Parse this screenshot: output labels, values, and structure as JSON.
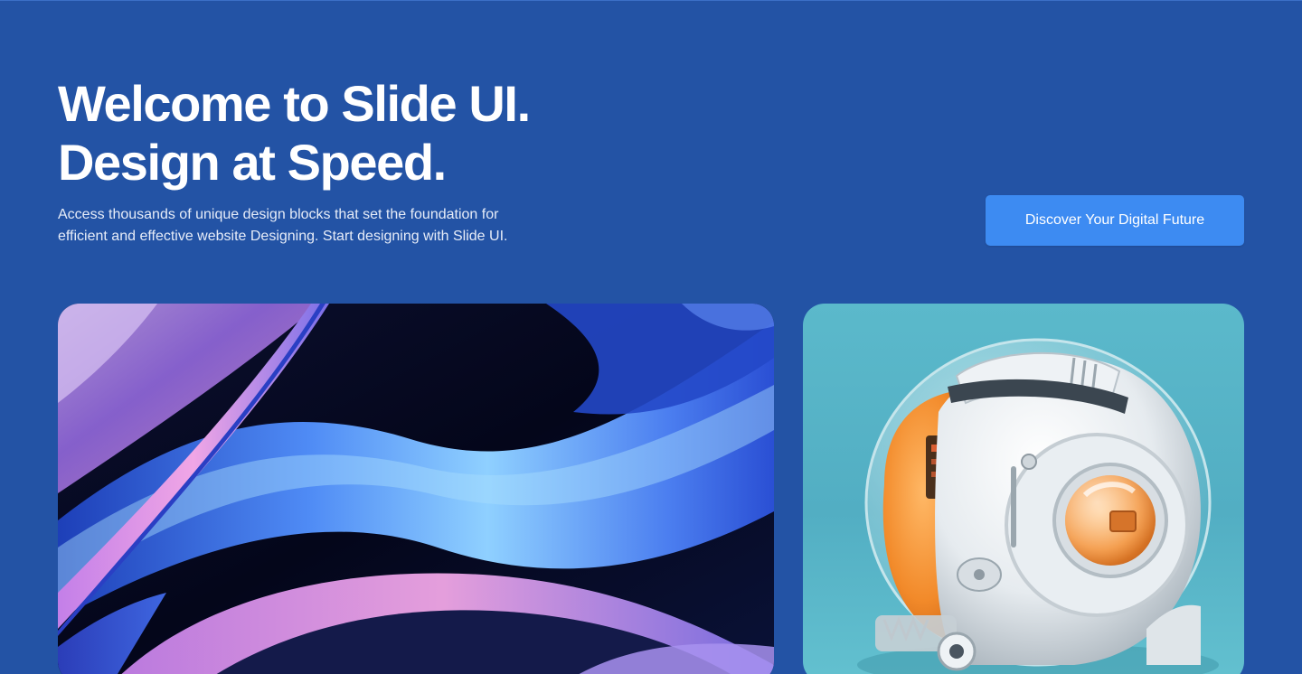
{
  "hero": {
    "headline_line1": "Welcome to Slide UI.",
    "headline_line2": "Design at Speed.",
    "subtext_line1": "Access thousands of unique design blocks that set the foundation for",
    "subtext_line2": "efficient and effective website Designing. Start designing with Slide UI.",
    "cta_label": "Discover Your Digital Future"
  },
  "colors": {
    "background": "#2353a5",
    "cta": "#3d8bf2",
    "text": "#ffffff"
  },
  "images": {
    "left": "abstract-wave-image",
    "right": "robot-capsule-image"
  }
}
